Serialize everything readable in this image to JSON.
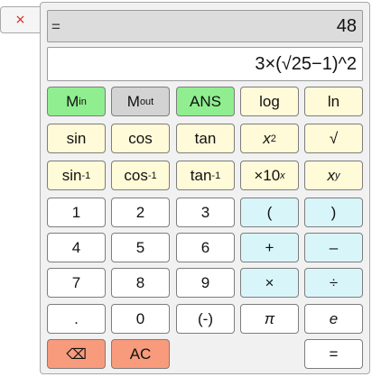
{
  "close_button": {
    "label": "×"
  },
  "display": {
    "result_prefix": "=",
    "result_value": "48",
    "expression": "3×(√25−1)^2"
  },
  "keys": {
    "m_in": {
      "main": "M",
      "sub": "in"
    },
    "m_out": {
      "main": "M",
      "sub": "out"
    },
    "ans": {
      "label": "ANS"
    },
    "log": {
      "label": "log"
    },
    "ln": {
      "label": "ln"
    },
    "sin": {
      "label": "sin"
    },
    "cos": {
      "label": "cos"
    },
    "tan": {
      "label": "tan"
    },
    "square": {
      "base": "x",
      "sup": "2"
    },
    "sqrt": {
      "label": "√"
    },
    "asin": {
      "main": "sin",
      "sup": "-1"
    },
    "acos": {
      "main": "cos",
      "sup": "-1"
    },
    "atan": {
      "main": "tan",
      "sup": "-1"
    },
    "exp10": {
      "main": "×10",
      "sup": "x"
    },
    "power": {
      "base": "x",
      "sup": "y"
    },
    "d1": {
      "label": "1"
    },
    "d2": {
      "label": "2"
    },
    "d3": {
      "label": "3"
    },
    "lparen": {
      "label": "("
    },
    "rparen": {
      "label": ")"
    },
    "d4": {
      "label": "4"
    },
    "d5": {
      "label": "5"
    },
    "d6": {
      "label": "6"
    },
    "plus": {
      "label": "+"
    },
    "minus": {
      "label": "–"
    },
    "d7": {
      "label": "7"
    },
    "d8": {
      "label": "8"
    },
    "d9": {
      "label": "9"
    },
    "times": {
      "label": "×"
    },
    "divide": {
      "label": "÷"
    },
    "decimal": {
      "label": "."
    },
    "d0": {
      "label": "0"
    },
    "negate": {
      "label": "(-)"
    },
    "pi": {
      "label": "π"
    },
    "e": {
      "label": "e"
    },
    "backspace": {
      "label": "⌫"
    },
    "ac": {
      "label": "AC"
    },
    "equals": {
      "label": "="
    }
  }
}
